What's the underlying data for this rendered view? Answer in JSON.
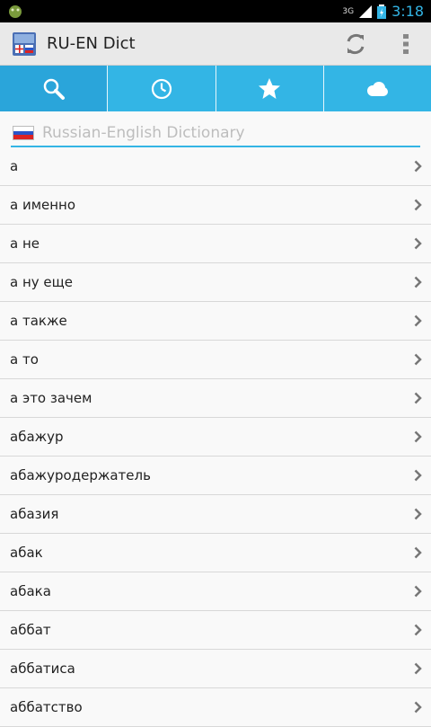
{
  "status": {
    "time": "3:18",
    "network": "3G"
  },
  "actionbar": {
    "title": "RU-EN Dict",
    "icon": "app-dictionary-icon",
    "actions": [
      "refresh-icon",
      "overflow-menu-icon"
    ]
  },
  "tabs": [
    {
      "icon": "search-icon",
      "active": true
    },
    {
      "icon": "clock-icon",
      "active": false
    },
    {
      "icon": "star-icon",
      "active": false
    },
    {
      "icon": "cloud-icon",
      "active": false
    }
  ],
  "search": {
    "placeholder": "Russian-English Dictionary",
    "value": ""
  },
  "colors": {
    "accent": "#33b5e5",
    "statusbar": "#000000",
    "actionbar": "#e9e9e9"
  },
  "words": [
    {
      "label": "а"
    },
    {
      "label": "а именно"
    },
    {
      "label": "а не"
    },
    {
      "label": "а ну еще"
    },
    {
      "label": "а также"
    },
    {
      "label": "а то"
    },
    {
      "label": "а это зачем"
    },
    {
      "label": "абажур"
    },
    {
      "label": "абажуродержатель"
    },
    {
      "label": "абазия"
    },
    {
      "label": "абак"
    },
    {
      "label": "абака"
    },
    {
      "label": "аббат"
    },
    {
      "label": "аббатиса"
    },
    {
      "label": "аббатство"
    }
  ]
}
